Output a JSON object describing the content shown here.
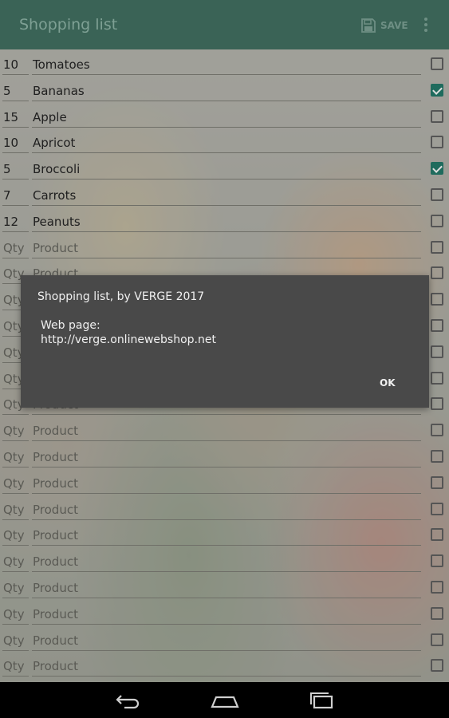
{
  "app": {
    "title": "Shopping list",
    "save_label": "SAVE",
    "accent": "#3a6356",
    "icons": [
      "save-icon",
      "overflow-menu-icon"
    ]
  },
  "list": {
    "qty_placeholder": "Qty",
    "product_placeholder": "Product",
    "checked_color": "#1f6b5d",
    "rows": [
      {
        "qty": "10",
        "product": "Tomatoes",
        "checked": false
      },
      {
        "qty": "5",
        "product": "Bananas",
        "checked": true
      },
      {
        "qty": "15",
        "product": "Apple",
        "checked": false
      },
      {
        "qty": "10",
        "product": "Apricot",
        "checked": false
      },
      {
        "qty": "5",
        "product": "Broccoli",
        "checked": true
      },
      {
        "qty": "7",
        "product": "Carrots",
        "checked": false
      },
      {
        "qty": "12",
        "product": "Peanuts",
        "checked": false
      },
      {
        "qty": "Qty",
        "product": "Product",
        "checked": false
      },
      {
        "qty": "Qty",
        "product": "Product",
        "checked": false
      },
      {
        "qty": "Qty",
        "product": "Product",
        "checked": false
      },
      {
        "qty": "Qty",
        "product": "Product",
        "checked": false
      },
      {
        "qty": "Qty",
        "product": "Product",
        "checked": false
      },
      {
        "qty": "Qty",
        "product": "Product",
        "checked": false
      },
      {
        "qty": "Qty",
        "product": "Product",
        "checked": false
      },
      {
        "qty": "Qty",
        "product": "Product",
        "checked": false
      },
      {
        "qty": "Qty",
        "product": "Product",
        "checked": false
      },
      {
        "qty": "Qty",
        "product": "Product",
        "checked": false
      },
      {
        "qty": "Qty",
        "product": "Product",
        "checked": false
      },
      {
        "qty": "Qty",
        "product": "Product",
        "checked": false
      },
      {
        "qty": "Qty",
        "product": "Product",
        "checked": false
      },
      {
        "qty": "Qty",
        "product": "Product",
        "checked": false
      },
      {
        "qty": "Qty",
        "product": "Product",
        "checked": false
      },
      {
        "qty": "Qty",
        "product": "Product",
        "checked": false
      },
      {
        "qty": "Qty",
        "product": "Product",
        "checked": false
      }
    ]
  },
  "dialog": {
    "title": "Shopping list, by VERGE 2017",
    "web_label": "Web page:",
    "url": "http://verge.onlinewebshop.net",
    "ok_label": "OK"
  },
  "nav": {
    "icons": [
      "back-icon",
      "home-icon",
      "recents-icon"
    ]
  }
}
